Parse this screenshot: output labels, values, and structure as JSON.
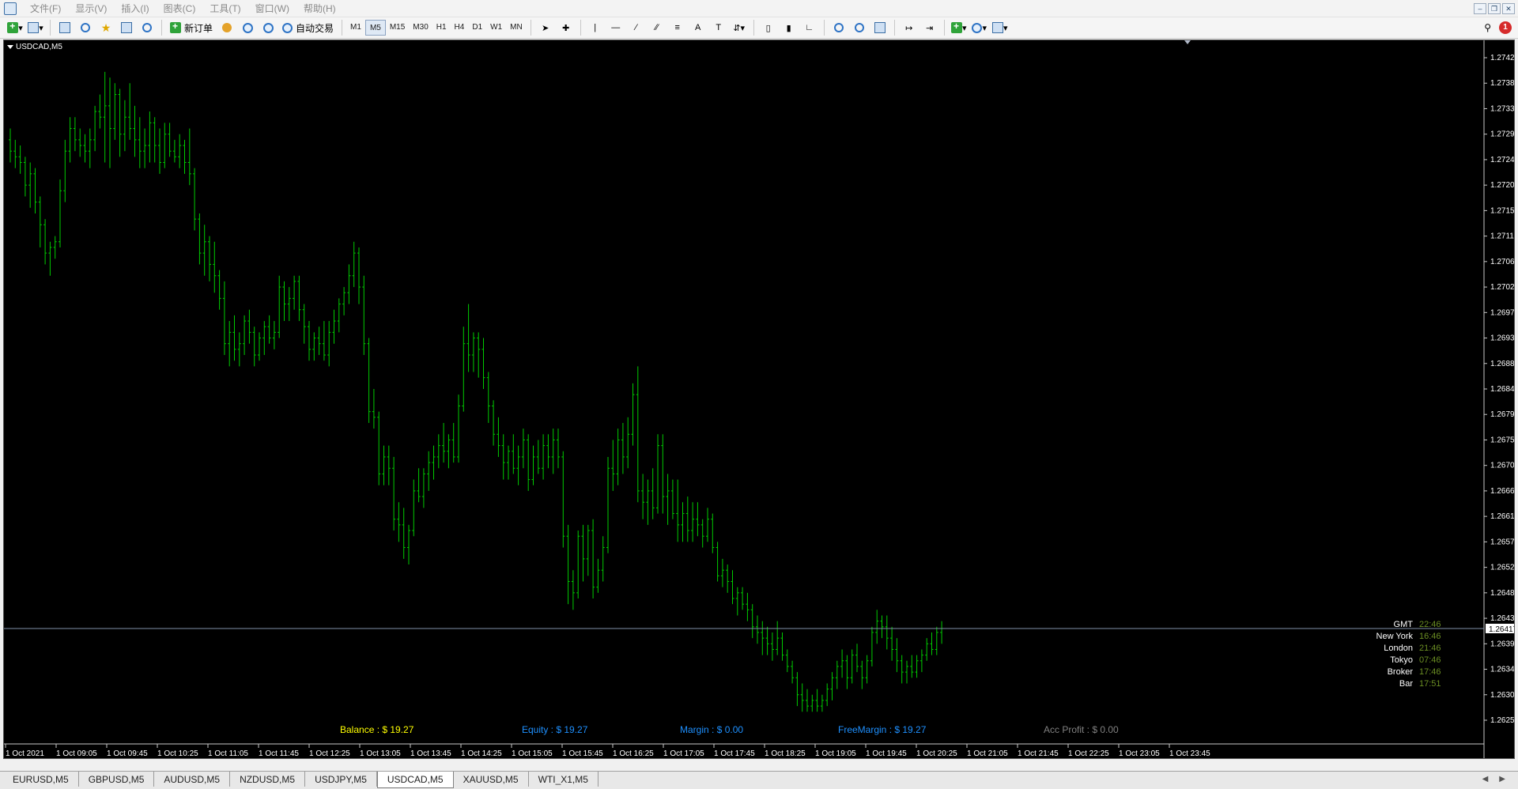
{
  "menu": [
    "文件(F)",
    "显示(V)",
    "插入(I)",
    "图表(C)",
    "工具(T)",
    "窗口(W)",
    "帮助(H)"
  ],
  "toolbar": {
    "new_order": "新订单",
    "auto_trading": "自动交易",
    "timeframes": [
      "M1",
      "M5",
      "M15",
      "M30",
      "H1",
      "H4",
      "D1",
      "W1",
      "MN"
    ],
    "active_timeframe": "M5",
    "letter_a": "A",
    "letter_t": "T",
    "notification_count": "1"
  },
  "chart": {
    "symbol_label": "USDCAD,M5",
    "current_price_label": "1.26417",
    "background": "#000000",
    "bar_color": "#00cc00",
    "price_line_color": "#8090a8"
  },
  "account": {
    "balance": "Balance : $ 19.27",
    "equity": "Equity : $ 19.27",
    "margin": "Margin : $ 0.00",
    "free_margin": "FreeMargin : $ 19.27",
    "acc_profit": "Acc Profit : $ 0.00",
    "colors": {
      "balance": "#ffff00",
      "equity": "#1e90ff",
      "margin": "#1e90ff",
      "free_margin": "#1e90ff",
      "acc_profit": "#808080"
    }
  },
  "clocks": [
    {
      "city": "GMT",
      "time": "22:46"
    },
    {
      "city": "New York",
      "time": "16:46"
    },
    {
      "city": "London",
      "time": "21:46"
    },
    {
      "city": "Tokyo",
      "time": "07:46"
    },
    {
      "city": "Broker",
      "time": "17:46"
    },
    {
      "city": "Bar",
      "time": "17:51"
    }
  ],
  "tabs": [
    "EURUSD,M5",
    "GBPUSD,M5",
    "AUDUSD,M5",
    "NZDUSD,M5",
    "USDJPY,M5",
    "USDCAD,M5",
    "XAUUSD,M5",
    "WTI_X1,M5"
  ],
  "active_tab": "USDCAD,M5",
  "chart_data": {
    "type": "ohlc",
    "price_ticks": [
      "1.27425",
      "1.27380",
      "1.27335",
      "1.27290",
      "1.27245",
      "1.27200",
      "1.27155",
      "1.27110",
      "1.27065",
      "1.27020",
      "1.26975",
      "1.26930",
      "1.26885",
      "1.26840",
      "1.26795",
      "1.26750",
      "1.26705",
      "1.26660",
      "1.26615",
      "1.26570",
      "1.26525",
      "1.26480",
      "1.26435",
      "1.26390",
      "1.26345",
      "1.26300",
      "1.26255"
    ],
    "time_ticks": [
      "1 Oct 2021",
      "1 Oct 09:05",
      "1 Oct 09:45",
      "1 Oct 10:25",
      "1 Oct 11:05",
      "1 Oct 11:45",
      "1 Oct 12:25",
      "1 Oct 13:05",
      "1 Oct 13:45",
      "1 Oct 14:25",
      "1 Oct 15:05",
      "1 Oct 15:45",
      "1 Oct 16:25",
      "1 Oct 17:05",
      "1 Oct 17:45",
      "1 Oct 18:25",
      "1 Oct 19:05",
      "1 Oct 19:45",
      "1 Oct 20:25",
      "1 Oct 21:05",
      "1 Oct 21:45",
      "1 Oct 22:25",
      "1 Oct 23:05",
      "1 Oct 23:45"
    ],
    "ylim": [
      1.26255,
      1.27425
    ],
    "current_price": 1.26417,
    "bars": [
      [
        1.2728,
        1.273,
        1.2724,
        1.2726
      ],
      [
        1.2726,
        1.2728,
        1.2723,
        1.2725
      ],
      [
        1.2725,
        1.2727,
        1.2722,
        1.2724
      ],
      [
        1.2724,
        1.2725,
        1.2718,
        1.272
      ],
      [
        1.272,
        1.2724,
        1.2716,
        1.2722
      ],
      [
        1.2722,
        1.2723,
        1.2715,
        1.2717
      ],
      [
        1.2717,
        1.2718,
        1.2709,
        1.2713
      ],
      [
        1.2713,
        1.2714,
        1.2706,
        1.2708
      ],
      [
        1.2708,
        1.271,
        1.2704,
        1.2709
      ],
      [
        1.2709,
        1.2711,
        1.2707,
        1.271
      ],
      [
        1.271,
        1.2721,
        1.2709,
        1.2719
      ],
      [
        1.2719,
        1.2728,
        1.2717,
        1.2726
      ],
      [
        1.2726,
        1.2732,
        1.2724,
        1.273
      ],
      [
        1.273,
        1.2732,
        1.2726,
        1.2728
      ],
      [
        1.2728,
        1.273,
        1.2725,
        1.2727
      ],
      [
        1.2727,
        1.2729,
        1.2724,
        1.2726
      ],
      [
        1.2726,
        1.273,
        1.2723,
        1.2728
      ],
      [
        1.2728,
        1.2734,
        1.2726,
        1.2733
      ],
      [
        1.2733,
        1.2736,
        1.273,
        1.2732
      ],
      [
        1.2732,
        1.274,
        1.2724,
        1.2734
      ],
      [
        1.2734,
        1.2739,
        1.2723,
        1.273
      ],
      [
        1.273,
        1.2738,
        1.2728,
        1.2736
      ],
      [
        1.2736,
        1.2737,
        1.2725,
        1.2729
      ],
      [
        1.2729,
        1.2735,
        1.2726,
        1.2732
      ],
      [
        1.2732,
        1.2738,
        1.2728,
        1.273
      ],
      [
        1.273,
        1.2734,
        1.2725,
        1.2728
      ],
      [
        1.2728,
        1.2732,
        1.2723,
        1.2726
      ],
      [
        1.2726,
        1.273,
        1.2723,
        1.2727
      ],
      [
        1.2727,
        1.2733,
        1.2724,
        1.2731
      ],
      [
        1.2731,
        1.2732,
        1.2724,
        1.2727
      ],
      [
        1.2727,
        1.273,
        1.2722,
        1.2724
      ],
      [
        1.2724,
        1.2731,
        1.2723,
        1.2729
      ],
      [
        1.2729,
        1.2731,
        1.2725,
        1.2726
      ],
      [
        1.2726,
        1.2728,
        1.2724,
        1.2725
      ],
      [
        1.2725,
        1.2729,
        1.2723,
        1.2727
      ],
      [
        1.2727,
        1.2728,
        1.2722,
        1.2724
      ],
      [
        1.2724,
        1.273,
        1.272,
        1.2722
      ],
      [
        1.2722,
        1.2723,
        1.2712,
        1.2714
      ],
      [
        1.2714,
        1.2715,
        1.2706,
        1.2708
      ],
      [
        1.2708,
        1.2713,
        1.2704,
        1.271
      ],
      [
        1.271,
        1.2711,
        1.2703,
        1.2706
      ],
      [
        1.2706,
        1.271,
        1.2701,
        1.2704
      ],
      [
        1.2704,
        1.2705,
        1.2698,
        1.27
      ],
      [
        1.27,
        1.2703,
        1.269,
        1.2692
      ],
      [
        1.2692,
        1.2696,
        1.2688,
        1.2694
      ],
      [
        1.2694,
        1.2697,
        1.2689,
        1.2691
      ],
      [
        1.2691,
        1.2694,
        1.2688,
        1.2692
      ],
      [
        1.2692,
        1.2697,
        1.269,
        1.2696
      ],
      [
        1.2696,
        1.2698,
        1.2692,
        1.2694
      ],
      [
        1.2694,
        1.2695,
        1.2688,
        1.269
      ],
      [
        1.269,
        1.2694,
        1.2689,
        1.2693
      ],
      [
        1.2693,
        1.2696,
        1.269,
        1.2695
      ],
      [
        1.2695,
        1.2697,
        1.2692,
        1.2693
      ],
      [
        1.2693,
        1.2696,
        1.2691,
        1.2694
      ],
      [
        1.2694,
        1.2704,
        1.2693,
        1.2702
      ],
      [
        1.2702,
        1.2703,
        1.2696,
        1.2699
      ],
      [
        1.2699,
        1.2702,
        1.2696,
        1.27
      ],
      [
        1.27,
        1.2704,
        1.2698,
        1.2703
      ],
      [
        1.2703,
        1.2704,
        1.2696,
        1.2698
      ],
      [
        1.2698,
        1.2699,
        1.2692,
        1.2695
      ],
      [
        1.2695,
        1.2696,
        1.2689,
        1.2691
      ],
      [
        1.2691,
        1.2694,
        1.2689,
        1.2693
      ],
      [
        1.2693,
        1.2695,
        1.269,
        1.2692
      ],
      [
        1.2692,
        1.2696,
        1.2689,
        1.269
      ],
      [
        1.269,
        1.2696,
        1.2688,
        1.2694
      ],
      [
        1.2694,
        1.2698,
        1.2692,
        1.2696
      ],
      [
        1.2696,
        1.27,
        1.2694,
        1.2699
      ],
      [
        1.2699,
        1.2702,
        1.2697,
        1.2701
      ],
      [
        1.2701,
        1.2706,
        1.2699,
        1.2704
      ],
      [
        1.2704,
        1.271,
        1.2702,
        1.2708
      ],
      [
        1.2708,
        1.2709,
        1.2699,
        1.2702
      ],
      [
        1.2702,
        1.2704,
        1.269,
        1.2692
      ],
      [
        1.2692,
        1.2693,
        1.2678,
        1.268
      ],
      [
        1.268,
        1.2684,
        1.2677,
        1.2679
      ],
      [
        1.2679,
        1.268,
        1.2667,
        1.2669
      ],
      [
        1.2669,
        1.2674,
        1.2667,
        1.2672
      ],
      [
        1.2672,
        1.2674,
        1.2667,
        1.267
      ],
      [
        1.267,
        1.2672,
        1.2659,
        1.2661
      ],
      [
        1.2661,
        1.2664,
        1.2657,
        1.266
      ],
      [
        1.266,
        1.2663,
        1.2654,
        1.2656
      ],
      [
        1.2656,
        1.266,
        1.2653,
        1.2659
      ],
      [
        1.2659,
        1.2668,
        1.2658,
        1.2666
      ],
      [
        1.2666,
        1.267,
        1.2664,
        1.2665
      ],
      [
        1.2665,
        1.267,
        1.2663,
        1.2669
      ],
      [
        1.2669,
        1.2673,
        1.2666,
        1.2671
      ],
      [
        1.2671,
        1.2674,
        1.2668,
        1.2672
      ],
      [
        1.2672,
        1.2676,
        1.267,
        1.2674
      ],
      [
        1.2674,
        1.2678,
        1.2671,
        1.2673
      ],
      [
        1.2673,
        1.2676,
        1.267,
        1.2675
      ],
      [
        1.2675,
        1.2678,
        1.2671,
        1.2672
      ],
      [
        1.2672,
        1.2683,
        1.2671,
        1.2681
      ],
      [
        1.2681,
        1.2695,
        1.268,
        1.2692
      ],
      [
        1.2692,
        1.2699,
        1.2687,
        1.269
      ],
      [
        1.269,
        1.2694,
        1.2687,
        1.2693
      ],
      [
        1.2693,
        1.2694,
        1.2686,
        1.2691
      ],
      [
        1.2691,
        1.2693,
        1.2684,
        1.2686
      ],
      [
        1.2686,
        1.2687,
        1.2678,
        1.2681
      ],
      [
        1.2681,
        1.2682,
        1.2674,
        1.2676
      ],
      [
        1.2676,
        1.2679,
        1.2672,
        1.2674
      ],
      [
        1.2674,
        1.2676,
        1.2668,
        1.2671
      ],
      [
        1.2671,
        1.2674,
        1.2668,
        1.2673
      ],
      [
        1.2673,
        1.2676,
        1.2669,
        1.267
      ],
      [
        1.267,
        1.2674,
        1.2667,
        1.2672
      ],
      [
        1.2672,
        1.2677,
        1.267,
        1.2675
      ],
      [
        1.2675,
        1.2676,
        1.2666,
        1.2668
      ],
      [
        1.2668,
        1.2674,
        1.2667,
        1.2672
      ],
      [
        1.2672,
        1.2675,
        1.2669,
        1.267
      ],
      [
        1.267,
        1.2676,
        1.2668,
        1.2674
      ],
      [
        1.2674,
        1.2676,
        1.267,
        1.2672
      ],
      [
        1.2672,
        1.2677,
        1.2669,
        1.2675
      ],
      [
        1.2675,
        1.2677,
        1.267,
        1.2672
      ],
      [
        1.2672,
        1.2673,
        1.2656,
        1.2658
      ],
      [
        1.2658,
        1.266,
        1.2646,
        1.265
      ],
      [
        1.265,
        1.2652,
        1.2645,
        1.2648
      ],
      [
        1.2648,
        1.2659,
        1.2647,
        1.2658
      ],
      [
        1.2658,
        1.266,
        1.265,
        1.2654
      ],
      [
        1.2654,
        1.266,
        1.2651,
        1.2659
      ],
      [
        1.2659,
        1.2661,
        1.2647,
        1.2649
      ],
      [
        1.2649,
        1.2654,
        1.2648,
        1.2652
      ],
      [
        1.2652,
        1.2658,
        1.265,
        1.2656
      ],
      [
        1.2656,
        1.2672,
        1.2655,
        1.267
      ],
      [
        1.267,
        1.2675,
        1.2666,
        1.2669
      ],
      [
        1.2669,
        1.2677,
        1.2667,
        1.2675
      ],
      [
        1.2675,
        1.2678,
        1.2669,
        1.2672
      ],
      [
        1.2672,
        1.2679,
        1.267,
        1.2676
      ],
      [
        1.2676,
        1.2685,
        1.2674,
        1.2683
      ],
      [
        1.2683,
        1.2688,
        1.2664,
        1.2666
      ],
      [
        1.2666,
        1.2669,
        1.2661,
        1.2664
      ],
      [
        1.2664,
        1.2668,
        1.266,
        1.2666
      ],
      [
        1.2666,
        1.267,
        1.2661,
        1.2663
      ],
      [
        1.2663,
        1.2676,
        1.2662,
        1.2674
      ],
      [
        1.2674,
        1.2676,
        1.2662,
        1.2665
      ],
      [
        1.2665,
        1.2669,
        1.266,
        1.2666
      ],
      [
        1.2666,
        1.2668,
        1.2661,
        1.2662
      ],
      [
        1.2662,
        1.2668,
        1.2657,
        1.266
      ],
      [
        1.266,
        1.2664,
        1.2657,
        1.2662
      ],
      [
        1.2662,
        1.2665,
        1.2657,
        1.2659
      ],
      [
        1.2659,
        1.2664,
        1.2657,
        1.2661
      ],
      [
        1.2661,
        1.2664,
        1.2658,
        1.266
      ],
      [
        1.266,
        1.2661,
        1.2656,
        1.2658
      ],
      [
        1.2658,
        1.2663,
        1.2657,
        1.2661
      ],
      [
        1.2661,
        1.2662,
        1.2655,
        1.2656
      ],
      [
        1.2656,
        1.2657,
        1.265,
        1.2651
      ],
      [
        1.2651,
        1.2654,
        1.2649,
        1.2652
      ],
      [
        1.2652,
        1.2653,
        1.2648,
        1.265
      ],
      [
        1.265,
        1.2652,
        1.2646,
        1.2647
      ],
      [
        1.2647,
        1.2649,
        1.2644,
        1.2648
      ],
      [
        1.2648,
        1.2649,
        1.2645,
        1.2646
      ],
      [
        1.2646,
        1.2648,
        1.2643,
        1.2645
      ],
      [
        1.2645,
        1.2646,
        1.264,
        1.2642
      ],
      [
        1.2642,
        1.2644,
        1.2639,
        1.2641
      ],
      [
        1.2641,
        1.2643,
        1.2637,
        1.264
      ],
      [
        1.264,
        1.2642,
        1.2637,
        1.2639
      ],
      [
        1.2639,
        1.2641,
        1.2636,
        1.2638
      ],
      [
        1.2638,
        1.2643,
        1.2637,
        1.264
      ],
      [
        1.264,
        1.2641,
        1.2636,
        1.2637
      ],
      [
        1.2637,
        1.2638,
        1.2634,
        1.2635
      ],
      [
        1.2635,
        1.2636,
        1.2632,
        1.2633
      ],
      [
        1.2633,
        1.2634,
        1.2628,
        1.263
      ],
      [
        1.263,
        1.2632,
        1.2627,
        1.2629
      ],
      [
        1.2629,
        1.2631,
        1.2627,
        1.2628
      ],
      [
        1.2628,
        1.263,
        1.2627,
        1.2629
      ],
      [
        1.2629,
        1.2631,
        1.2627,
        1.2628
      ],
      [
        1.2628,
        1.263,
        1.2627,
        1.2629
      ],
      [
        1.2629,
        1.2632,
        1.2628,
        1.2631
      ],
      [
        1.2631,
        1.2634,
        1.2629,
        1.2633
      ],
      [
        1.2633,
        1.2636,
        1.2631,
        1.2635
      ],
      [
        1.2635,
        1.2638,
        1.2633,
        1.2636
      ],
      [
        1.2636,
        1.2637,
        1.2631,
        1.2633
      ],
      [
        1.2633,
        1.2638,
        1.2632,
        1.2637
      ],
      [
        1.2637,
        1.2639,
        1.2634,
        1.2635
      ],
      [
        1.2635,
        1.2636,
        1.2631,
        1.2633
      ],
      [
        1.2633,
        1.2637,
        1.2632,
        1.2636
      ],
      [
        1.2636,
        1.2642,
        1.2635,
        1.2641
      ],
      [
        1.2641,
        1.2645,
        1.2639,
        1.2643
      ],
      [
        1.2643,
        1.2644,
        1.264,
        1.2642
      ],
      [
        1.2642,
        1.2644,
        1.2638,
        1.264
      ],
      [
        1.264,
        1.2642,
        1.2636,
        1.2638
      ],
      [
        1.2638,
        1.264,
        1.2634,
        1.2636
      ],
      [
        1.2636,
        1.2637,
        1.2632,
        1.2634
      ],
      [
        1.2634,
        1.2636,
        1.2632,
        1.2635
      ],
      [
        1.2635,
        1.2637,
        1.2633,
        1.2634
      ],
      [
        1.2634,
        1.2637,
        1.2633,
        1.2636
      ],
      [
        1.2636,
        1.2638,
        1.2634,
        1.2637
      ],
      [
        1.2637,
        1.264,
        1.2636,
        1.2639
      ],
      [
        1.2639,
        1.2641,
        1.2637,
        1.2638
      ],
      [
        1.2638,
        1.2642,
        1.2637,
        1.2641
      ],
      [
        1.2641,
        1.2643,
        1.2639,
        1.26417
      ]
    ]
  }
}
